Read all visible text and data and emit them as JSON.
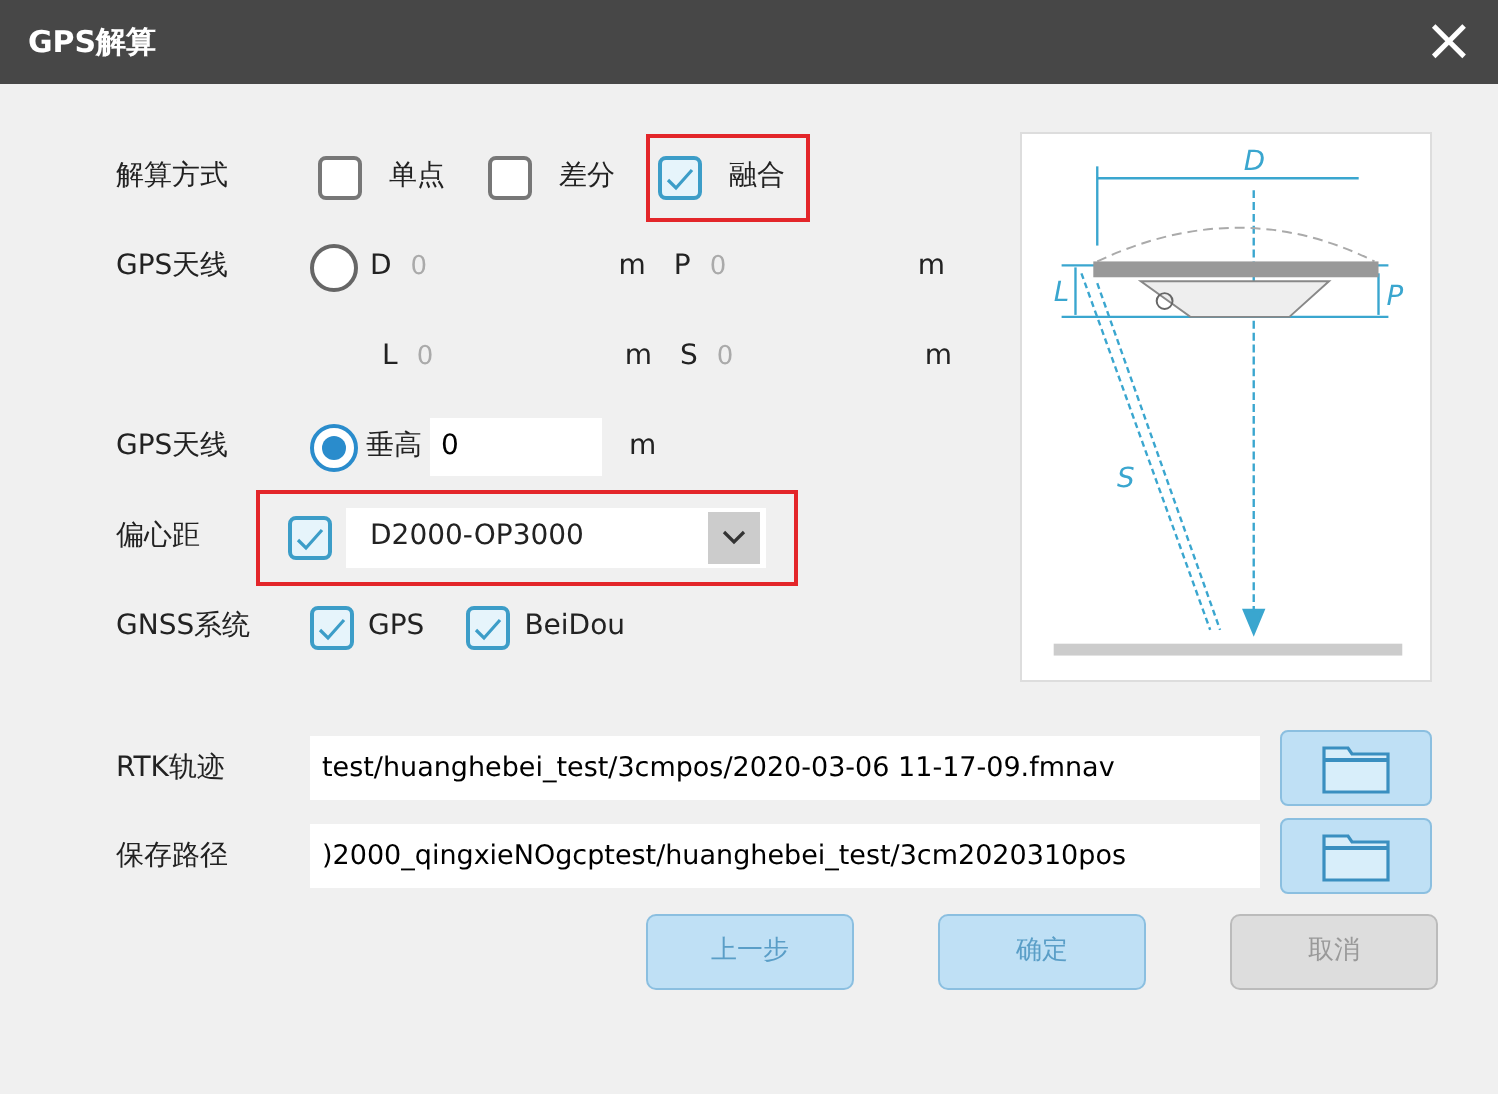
{
  "window": {
    "title": "GPS解算",
    "close": "×"
  },
  "solution_mode": {
    "label": "解算方式",
    "options": [
      {
        "label": "单点",
        "checked": false,
        "highlighted": false
      },
      {
        "label": "差分",
        "checked": false,
        "highlighted": false
      },
      {
        "label": "融合",
        "checked": true,
        "highlighted": true
      }
    ]
  },
  "antenna_params": {
    "label": "GPS天线",
    "selected": false,
    "fields": [
      {
        "name": "D",
        "value": "0",
        "unit": "m"
      },
      {
        "name": "P",
        "value": "0",
        "unit": "m"
      },
      {
        "name": "L",
        "value": "0",
        "unit": "m"
      },
      {
        "name": "S",
        "value": "0",
        "unit": "m"
      }
    ]
  },
  "antenna_height": {
    "label": "GPS天线",
    "selected": true,
    "name": "垂高",
    "value": "0",
    "unit": "m"
  },
  "offset": {
    "label": "偏心距",
    "checked": true,
    "value": "D2000-OP3000",
    "highlighted": true
  },
  "gnss": {
    "label": "GNSS系统",
    "options": [
      {
        "label": "GPS",
        "checked": true
      },
      {
        "label": "BeiDou",
        "checked": true
      }
    ]
  },
  "diagram": {
    "labels": [
      "D",
      "L",
      "P",
      "S"
    ]
  },
  "paths": [
    {
      "label": "RTK轨迹",
      "value": "test/huanghebei_test/3cmpos/2020-03-06 11-17-09.fmnav"
    },
    {
      "label": "保存路径",
      "value": ")2000_qingxieNOgcptest/huanghebei_test/3cm2020310pos"
    }
  ],
  "buttons": [
    {
      "label": "上一步",
      "disabled": false
    },
    {
      "label": "确定",
      "disabled": false
    },
    {
      "label": "取消",
      "disabled": true
    }
  ]
}
